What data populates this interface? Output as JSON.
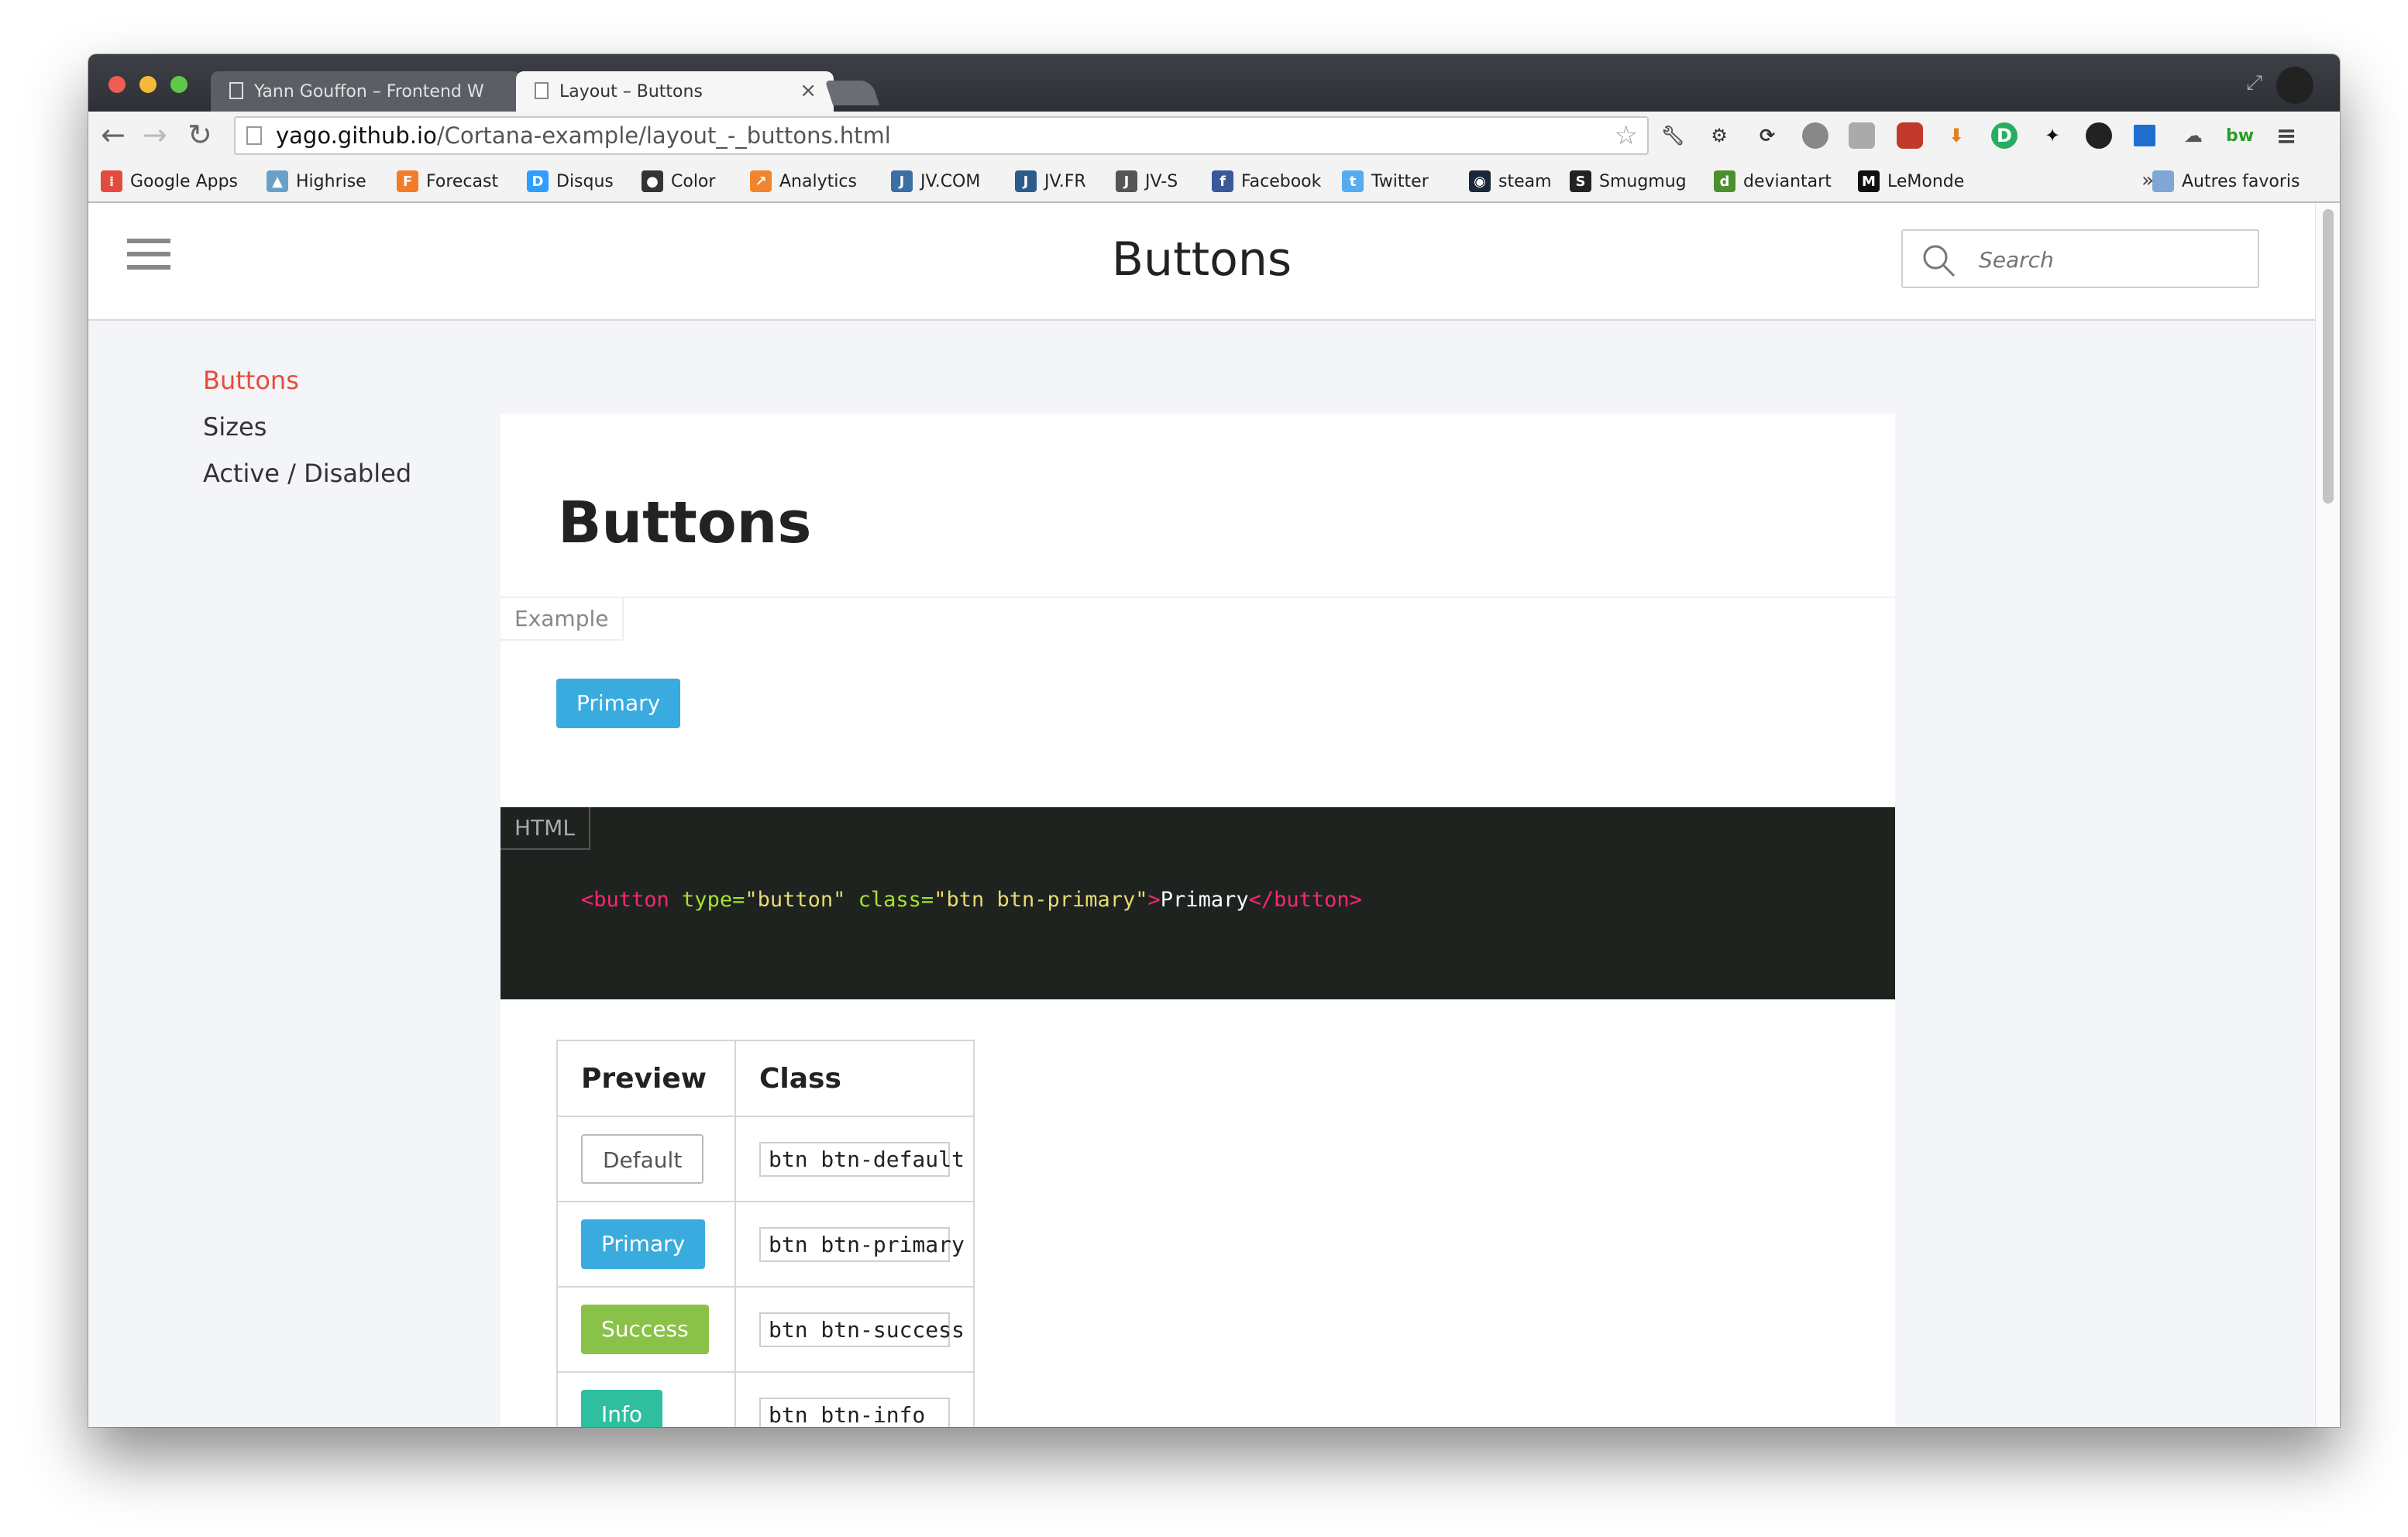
{
  "browser": {
    "tabs": [
      {
        "title": "Yann Gouffon – Frontend W",
        "active": false
      },
      {
        "title": "Layout – Buttons",
        "active": true
      }
    ],
    "url_domain": "yago.github.io",
    "url_path": "/Cortana-example/layout_-_buttons.html",
    "bookmarks": [
      {
        "label": "Google Apps",
        "icon": "apps-grid-icon",
        "color": "#e24c3f"
      },
      {
        "label": "Highrise",
        "icon": "highrise-icon",
        "color": "#6aa0c8"
      },
      {
        "label": "Forecast",
        "icon": "forecast-icon",
        "color": "#f27c2a"
      },
      {
        "label": "Disqus",
        "icon": "disqus-icon",
        "color": "#2e9fff"
      },
      {
        "label": "Color",
        "icon": "color-icon",
        "color": "#333333"
      },
      {
        "label": "Analytics",
        "icon": "analytics-icon",
        "color": "#f0852d"
      },
      {
        "label": "JV.COM",
        "icon": "jvcom-icon",
        "color": "#3a6ea5"
      },
      {
        "label": "JV.FR",
        "icon": "jvfr-icon",
        "color": "#2d5b8a"
      },
      {
        "label": "JV-S",
        "icon": "jvs-icon",
        "color": "#555555"
      },
      {
        "label": "Facebook",
        "icon": "facebook-icon",
        "color": "#3b5998"
      },
      {
        "label": "Twitter",
        "icon": "twitter-icon",
        "color": "#55acee"
      },
      {
        "label": "steam",
        "icon": "steam-icon",
        "color": "#1b2838"
      },
      {
        "label": "Smugmug",
        "icon": "smugmug-icon",
        "color": "#222222"
      },
      {
        "label": "deviantart",
        "icon": "deviantart-icon",
        "color": "#4d8f2f"
      },
      {
        "label": "LeMonde",
        "icon": "lemonde-icon",
        "color": "#111111"
      }
    ],
    "bookmarks_more": "»",
    "other_bookmarks": "Autres favoris"
  },
  "site": {
    "title": "Buttons",
    "search_placeholder": "Search",
    "nav": [
      {
        "label": "Buttons",
        "active": true
      },
      {
        "label": "Sizes",
        "active": false
      },
      {
        "label": "Active / Disabled",
        "active": false
      }
    ]
  },
  "content": {
    "heading": "Buttons",
    "example_label": "Example",
    "example_button": "Primary",
    "code_label": "HTML",
    "code": {
      "open_tag": "<button",
      "attr1": " type=",
      "val1": "\"button\"",
      "attr2": " class=",
      "val2": "\"btn btn-primary\"",
      "close_bracket": ">",
      "text": "Primary",
      "end_tag": "</button>"
    },
    "table": {
      "headers": [
        "Preview",
        "Class"
      ],
      "rows": [
        {
          "label": "Default",
          "class": "btn btn-default",
          "style": "default"
        },
        {
          "label": "Primary",
          "class": "btn btn-primary",
          "style": "primary"
        },
        {
          "label": "Success",
          "class": "btn btn-success",
          "style": "success"
        },
        {
          "label": "Info",
          "class": "btn btn-info",
          "style": "info"
        }
      ]
    }
  },
  "colors": {
    "accent_active_nav": "#e74c3c",
    "primary": "#3aabde",
    "success": "#8ac249",
    "info": "#2fbf9f"
  }
}
